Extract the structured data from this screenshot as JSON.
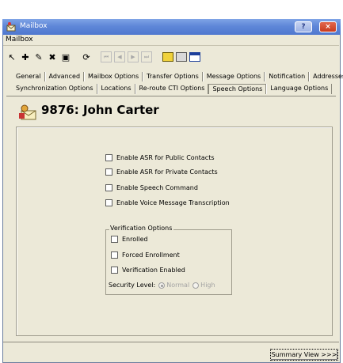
{
  "window": {
    "title": "Mailbox",
    "help_button": "?",
    "close_button": "×"
  },
  "menubar": {
    "items": [
      "Mailbox"
    ]
  },
  "toolbar": {
    "buttons": [
      {
        "icon": "cursor-icon",
        "glyph": "↖"
      },
      {
        "icon": "add-icon",
        "glyph": "✚"
      },
      {
        "icon": "edit-icon",
        "glyph": "✎"
      },
      {
        "icon": "delete-icon",
        "glyph": "✖"
      },
      {
        "icon": "save-icon",
        "glyph": "▣"
      },
      {
        "icon": "refresh-icon",
        "glyph": "⟳"
      }
    ],
    "nav": [
      "⏮",
      "◀",
      "▶",
      "⏭"
    ]
  },
  "tabs": {
    "row1": [
      "General",
      "Advanced",
      "Mailbox Options",
      "Transfer Options",
      "Message Options",
      "Notification",
      "Addresses"
    ],
    "row2": [
      "Synchronization Options",
      "Locations",
      "Re-route CTI Options",
      "Speech Options",
      "Language Options"
    ],
    "active": "Speech Options"
  },
  "header": {
    "title": "9876: John Carter"
  },
  "speech": {
    "options": [
      {
        "label": "Enable ASR for Public Contacts",
        "checked": false
      },
      {
        "label": "Enable ASR for Private Contacts",
        "checked": false
      },
      {
        "label": "Enable Speech Command",
        "checked": false
      },
      {
        "label": "Enable Voice Message Transcription",
        "checked": false
      }
    ],
    "verification": {
      "title": "Verification Options",
      "options": [
        {
          "label": "Enrolled",
          "checked": false
        },
        {
          "label": "Forced Enrollment",
          "checked": false
        },
        {
          "label": "Verification Enabled",
          "checked": false
        }
      ],
      "security_label": "Security Level:",
      "levels": [
        "Normal",
        "High"
      ],
      "selected": "Normal"
    }
  },
  "footer": {
    "summary_button": "Summary View >>>"
  },
  "colors": {
    "titlebar": "#5f87d8",
    "window_bg": "#ece9d8"
  }
}
